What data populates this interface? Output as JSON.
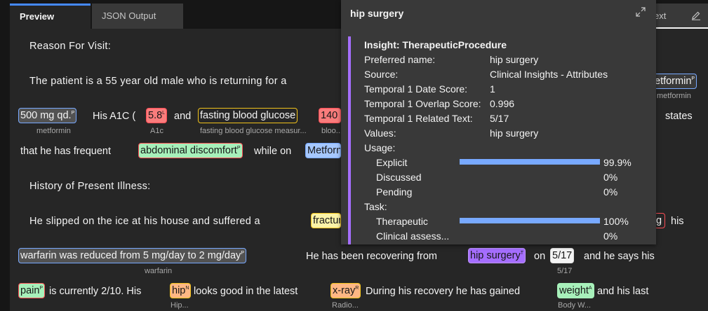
{
  "tabs": {
    "preview": "Preview",
    "json_output": "JSON Output"
  },
  "topbar": {
    "text_label": "ext"
  },
  "document": {
    "line1": "Reason  For  Visit:",
    "line2": "The   patient   is   a   55   year   old   male   who   is   returning   for   a",
    "line3_his_a1c": "His  A1C  (",
    "line3_and": "and",
    "line3_states": "states",
    "line4_that": "that   he   has   frequent",
    "line4_while": "while   on",
    "line5": "History   of   Present   Illness:",
    "line6": "He   slipped   on   the   ice   at   his   house   and   suffered   a",
    "line6_his": "his",
    "line7_mid": "He   has   been   recovering   from",
    "line7_on": "on",
    "line7_end": "and   he   says   his",
    "line8_a": "is   currently   2/10.   His",
    "line8_b": "looks   good   in   the   latest",
    "line8_c": "During   his   recovery   he   has   gained",
    "line8_d": "and   his   last"
  },
  "annotations": {
    "metformin_right": {
      "text": "etformin",
      "sup": "P",
      "sub": "metformin"
    },
    "dose": {
      "text": "500   mg   qd.",
      "sup": "P",
      "sub": "metformin"
    },
    "a1c_value": {
      "text": "5.8",
      "sup": "L",
      "sub": "A1c"
    },
    "fbg": {
      "text": "fasting   blood   glucose",
      "sub": "fasting blood glucose measur..."
    },
    "fbg_value": {
      "text": "140",
      "sub": "bloo..."
    },
    "abdominal": {
      "text": "abdominal   discomfort",
      "sup": "P"
    },
    "metformin_mid": {
      "text": "Metforn"
    },
    "fracture": {
      "text": "fractur"
    },
    "warfarin": {
      "text": "warfarin   was   reduced   from   5   mg/day   to   2   mg/day",
      "sup": "P",
      "sub": "warfarin"
    },
    "hip_surgery": {
      "text": "hip   surgery",
      "sup": "T"
    },
    "date": {
      "text": "5/17",
      "sub": "5/17"
    },
    "pain": {
      "text": "pain",
      "sup": "P"
    },
    "hip": {
      "text": "hip",
      "sup": "N",
      "sub": "Hip..."
    },
    "xray": {
      "text": "x-ray",
      "sup": "R",
      "sub": "Radio..."
    },
    "weight": {
      "text": "weight",
      "sup": "A",
      "sub": "Body W..."
    },
    "small_g": {
      "text": "g"
    }
  },
  "popup": {
    "title": "hip surgery",
    "insight": "Insight: TherapeuticProcedure",
    "fields": [
      {
        "label": "Preferred name:",
        "value": "hip surgery"
      },
      {
        "label": "Source:",
        "value": "Clinical Insights - Attributes"
      },
      {
        "label": "Temporal 1 Date Score:",
        "value": "1"
      },
      {
        "label": "Temporal 1 Overlap Score:",
        "value": "0.996"
      },
      {
        "label": "Temporal 1 Related Text:",
        "value": "5/17"
      },
      {
        "label": "Values:",
        "value": "hip surgery"
      }
    ],
    "usage_label": "Usage:",
    "usage": [
      {
        "label": "Explicit",
        "pct": "99.9%",
        "fill": 0.999
      },
      {
        "label": "Discussed",
        "pct": "0%",
        "fill": 0
      },
      {
        "label": "Pending",
        "pct": "0%",
        "fill": 0
      }
    ],
    "task_label": "Task:",
    "task": [
      {
        "label": "Therapeutic",
        "pct": "100%",
        "fill": 1.0
      },
      {
        "label": "Clinical assess...",
        "pct": "0%",
        "fill": 0
      }
    ]
  },
  "colors": {
    "accent_blue": "#4589ff",
    "meter_blue": "#78a9ff",
    "insight_purple": "#a56eff",
    "annotation_red": "#fa4d56",
    "annotation_yellow": "#f1c21b",
    "annotation_blue": "#78a9ff",
    "annotation_purple": "#be95ff",
    "annotation_green": "#a7f0ba"
  }
}
